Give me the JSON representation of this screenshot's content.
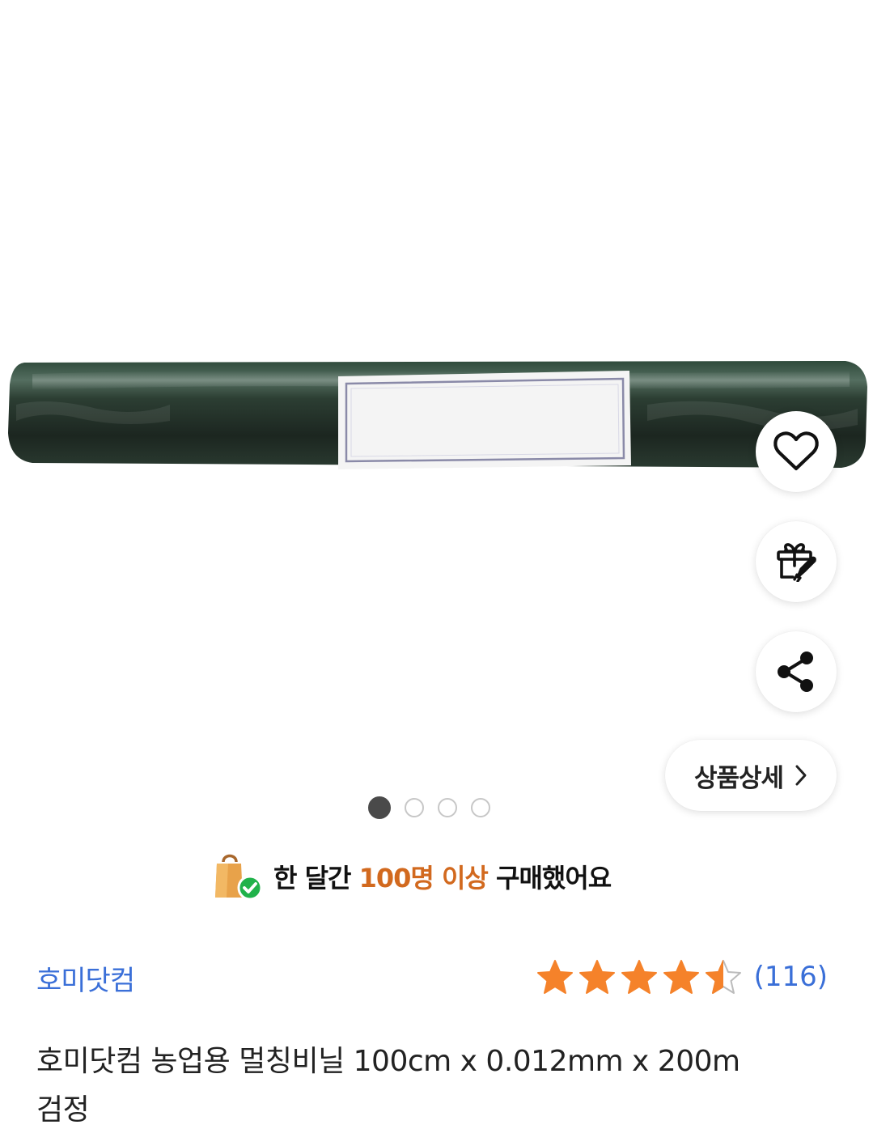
{
  "gallery": {
    "image_alt": "",
    "dots": [
      {
        "active": true
      },
      {
        "active": false
      },
      {
        "active": false
      },
      {
        "active": false
      }
    ]
  },
  "actions": {
    "like_icon": "heart-icon",
    "gift_icon": "gift-rocket-icon",
    "share_icon": "share-icon",
    "detail_label": "상품상세",
    "detail_icon": "chevron-right-icon"
  },
  "purchase_notice": {
    "icon": "shopping-bag-check-icon",
    "prefix": "한 달간 ",
    "highlight": "100명 이상",
    "suffix": " 구매했어요",
    "highlight_color": "#d2691e"
  },
  "seller": {
    "name": "호미닷컴"
  },
  "rating": {
    "stars": 4.5,
    "count_text": "(116)",
    "star_color": "#f5822a"
  },
  "product": {
    "title": "호미닷컴 농업용 멀칭비닐 100cm x 0.012mm x 200m 검정"
  },
  "colors": {
    "link_blue": "#3a6fd8",
    "text_dark": "#222222"
  }
}
